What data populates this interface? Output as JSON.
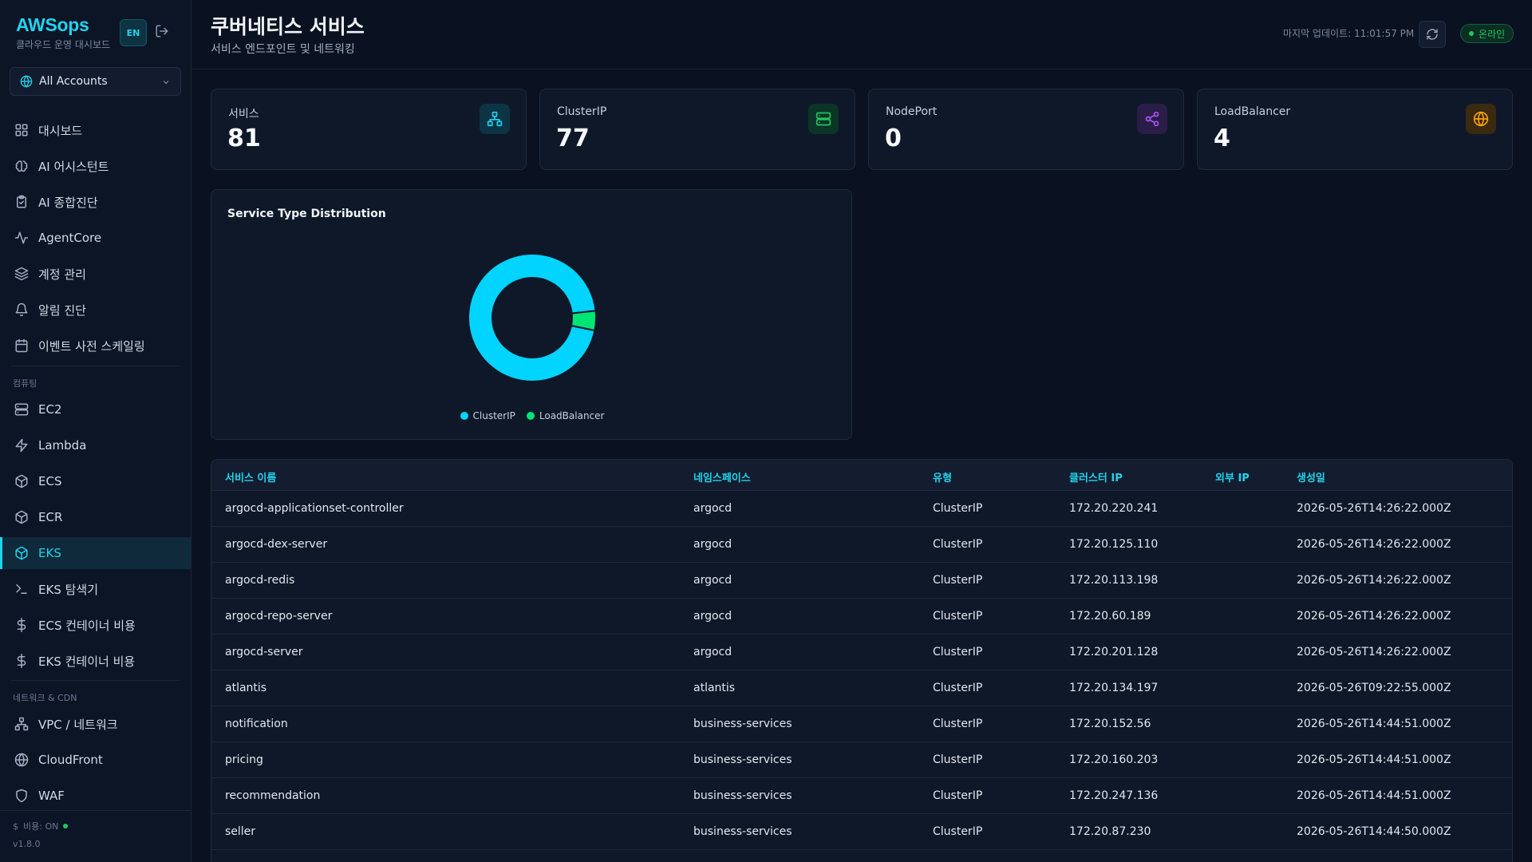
{
  "sidebar": {
    "brand_title": "AWSops",
    "brand_subtitle": "클라우드 운영 대시보드",
    "lang_button": "EN",
    "account_select": "All Accounts",
    "items_top": [
      {
        "label": "대시보드",
        "icon": "grid-icon"
      },
      {
        "label": "AI 어시스턴트",
        "icon": "brain-icon"
      },
      {
        "label": "AI 종합진단",
        "icon": "clipboard-check-icon"
      },
      {
        "label": "AgentCore",
        "icon": "activity-icon"
      },
      {
        "label": "계정 관리",
        "icon": "layers-icon"
      },
      {
        "label": "알림 진단",
        "icon": "bell-icon"
      },
      {
        "label": "이벤트 사전 스케일링",
        "icon": "calendar-icon"
      }
    ],
    "section_compute": "컴퓨팅",
    "items_compute": [
      {
        "label": "EC2",
        "icon": "server-icon"
      },
      {
        "label": "Lambda",
        "icon": "zap-icon"
      },
      {
        "label": "ECS",
        "icon": "box-icon"
      },
      {
        "label": "ECR",
        "icon": "box-icon"
      },
      {
        "label": "EKS",
        "icon": "box-icon",
        "active": true
      },
      {
        "label": "EKS 탐색기",
        "icon": "terminal-icon"
      },
      {
        "label": "ECS 컨테이너 비용",
        "icon": "dollar-icon"
      },
      {
        "label": "EKS 컨테이너 비용",
        "icon": "dollar-icon"
      }
    ],
    "section_network": "네트워크 & CDN",
    "items_network": [
      {
        "label": "VPC / 네트워크",
        "icon": "network-icon"
      },
      {
        "label": "CloudFront",
        "icon": "globe-icon"
      },
      {
        "label": "WAF",
        "icon": "shield-icon"
      }
    ],
    "cost_status": "비용: ON",
    "version": "v1.8.0"
  },
  "header": {
    "title": "쿠버네티스 서비스",
    "subtitle": "서비스 엔드포인트 및 네트워킹",
    "last_update": "마지막 업데이트: 11:01:57 PM",
    "status": "온라인"
  },
  "stats": [
    {
      "label": "서비스",
      "value": "81",
      "icon": "network-icon",
      "color": "#22d3ee",
      "bg": "#0c3445"
    },
    {
      "label": "ClusterIP",
      "value": "77",
      "icon": "server-icon",
      "color": "#22c55e",
      "bg": "#0b3527"
    },
    {
      "label": "NodePort",
      "value": "0",
      "icon": "share-icon",
      "color": "#a855f7",
      "bg": "#2a1d47"
    },
    {
      "label": "LoadBalancer",
      "value": "4",
      "icon": "globe-icon",
      "color": "#f59e0b",
      "bg": "#3a2a10"
    }
  ],
  "chart_data": {
    "type": "pie",
    "title": "Service Type Distribution",
    "categories": [
      "ClusterIP",
      "LoadBalancer"
    ],
    "values": [
      77,
      4
    ],
    "colors": [
      "#00d4ff",
      "#00e676"
    ],
    "legend": "bottom"
  },
  "table": {
    "columns": [
      "서비스 이름",
      "네임스페이스",
      "유형",
      "클러스터 IP",
      "외부 IP",
      "생성일"
    ],
    "rows": [
      [
        "argocd-applicationset-controller",
        "argocd",
        "ClusterIP",
        "172.20.220.241",
        "",
        "2026-05-26T14:26:22.000Z"
      ],
      [
        "argocd-dex-server",
        "argocd",
        "ClusterIP",
        "172.20.125.110",
        "",
        "2026-05-26T14:26:22.000Z"
      ],
      [
        "argocd-redis",
        "argocd",
        "ClusterIP",
        "172.20.113.198",
        "",
        "2026-05-26T14:26:22.000Z"
      ],
      [
        "argocd-repo-server",
        "argocd",
        "ClusterIP",
        "172.20.60.189",
        "",
        "2026-05-26T14:26:22.000Z"
      ],
      [
        "argocd-server",
        "argocd",
        "ClusterIP",
        "172.20.201.128",
        "",
        "2026-05-26T14:26:22.000Z"
      ],
      [
        "atlantis",
        "atlantis",
        "ClusterIP",
        "172.20.134.197",
        "",
        "2026-05-26T09:22:55.000Z"
      ],
      [
        "notification",
        "business-services",
        "ClusterIP",
        "172.20.152.56",
        "",
        "2026-05-26T14:44:51.000Z"
      ],
      [
        "pricing",
        "business-services",
        "ClusterIP",
        "172.20.160.203",
        "",
        "2026-05-26T14:44:51.000Z"
      ],
      [
        "recommendation",
        "business-services",
        "ClusterIP",
        "172.20.247.136",
        "",
        "2026-05-26T14:44:51.000Z"
      ],
      [
        "seller",
        "business-services",
        "ClusterIP",
        "172.20.87.230",
        "",
        "2026-05-26T14:44:50.000Z"
      ]
    ]
  }
}
